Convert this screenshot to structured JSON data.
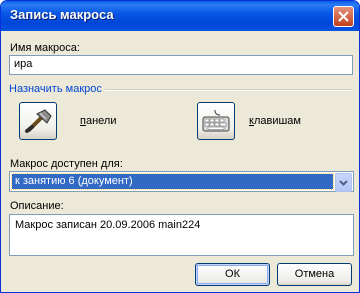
{
  "window": {
    "title": "Запись макроса"
  },
  "macro_name": {
    "label": "Имя макроса:",
    "value": "ира"
  },
  "assign": {
    "label": "Назначить макрос",
    "toolbar_label": "панели",
    "toolbar_icon": "hammer-icon",
    "keyboard_label": "клавишам",
    "keyboard_icon": "keyboard-icon"
  },
  "available": {
    "label": "Макрос доступен для:",
    "selected": "к занятию 6 (документ)"
  },
  "description": {
    "label": "Описание:",
    "value": "Макрос записан 20.09.2006 main224"
  },
  "buttons": {
    "ok": "ОК",
    "cancel": "Отмена"
  },
  "colors": {
    "titlebar": "#0054e3",
    "accent": "#0046d5",
    "selection": "#316ac5",
    "dialog": "#ece9d8"
  }
}
